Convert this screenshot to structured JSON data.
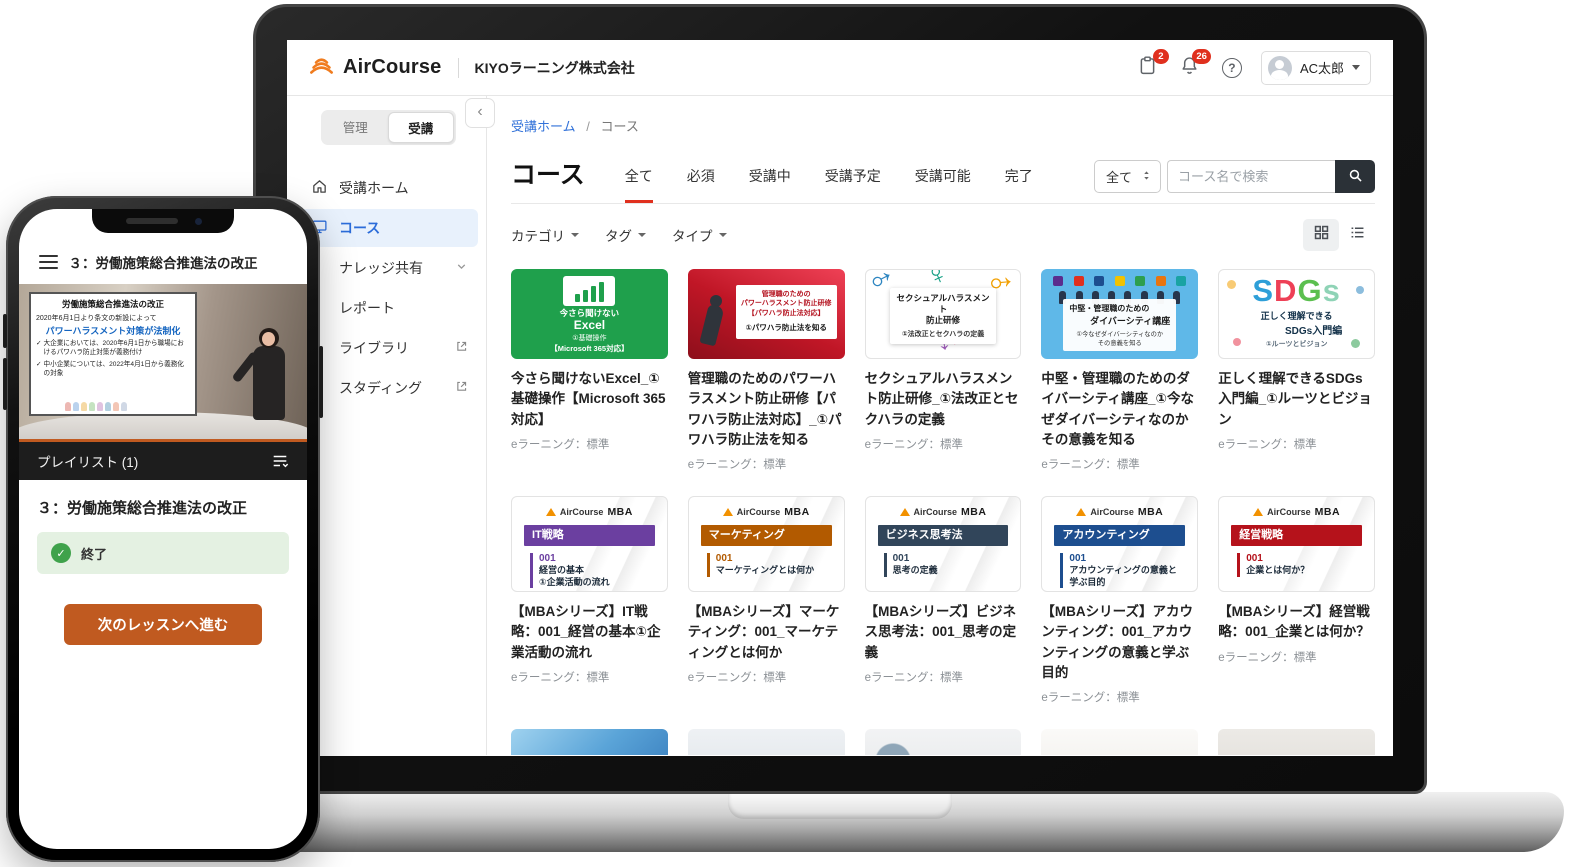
{
  "header": {
    "brand": "AirCourse",
    "company": "KIYOラーニング株式会社",
    "badges": {
      "tasks": "2",
      "alerts": "26"
    },
    "user": {
      "name": "AC太郎"
    }
  },
  "sidebar": {
    "toggle": {
      "admin": "管理",
      "learner": "受講"
    },
    "items": [
      {
        "label": "受講ホーム"
      },
      {
        "label": "コース"
      },
      {
        "label": "ナレッジ共有"
      },
      {
        "label": "レポート"
      },
      {
        "label": "ライブラリ"
      },
      {
        "label": "スタディング"
      }
    ]
  },
  "main": {
    "breadcrumb": {
      "home": "受講ホーム",
      "separator": "/",
      "current": "コース"
    },
    "title": "コース",
    "tabs": [
      {
        "label": "全て"
      },
      {
        "label": "必須"
      },
      {
        "label": "受講中"
      },
      {
        "label": "受講予定"
      },
      {
        "label": "受講可能"
      },
      {
        "label": "完了"
      }
    ],
    "search": {
      "category": "全て",
      "placeholder": "コース名で検索"
    },
    "filters": [
      {
        "label": "カテゴリ"
      },
      {
        "label": "タグ"
      },
      {
        "label": "タイプ"
      }
    ]
  },
  "courses": {
    "row1": [
      {
        "title": "今さら聞けないExcel_①基礎操作【Microsoft 365対応】",
        "meta": "eラーニング：標準",
        "thumb": {
          "line1": "今さら聞けない",
          "line2": "Excel",
          "line3": "①基礎操作",
          "line4": "【Microsoft 365対応】"
        }
      },
      {
        "title": "管理職のためのパワーハラスメント防止研修【パワハラ防止法対応】_①パワハラ防止法を知る",
        "meta": "eラーニング：標準",
        "thumb": {
          "line1": "管理職のための",
          "line2": "パワーハラスメント防止研修",
          "line3": "【パワハラ防止法対応】",
          "line4": "①パワハラ防止法を知る"
        }
      },
      {
        "title": "セクシュアルハラスメント防止研修_①法改正とセクハラの定義",
        "meta": "eラーニング：標準",
        "thumb": {
          "line1": "セクシュアルハラスメント",
          "line2": "防止研修",
          "line3": "①法改正とセクハラの定義"
        }
      },
      {
        "title": "中堅・管理職のためのダイバーシティ講座_①今なぜダイバーシティなのかその意義を知る",
        "meta": "eラーニング：標準",
        "thumb": {
          "line1": "中堅・管理職のための",
          "line2": "ダイバーシティ講座",
          "line3": "①今なぜダイバーシティなのか",
          "line4": "その意義を知る"
        }
      },
      {
        "title": "正しく理解できるSDGs入門編_①ルーツとビジョン",
        "meta": "eラーニング：標準",
        "thumb": {
          "big_s": "S",
          "big_d": "D",
          "big_g": "G",
          "big_s2": "s",
          "line1": "正しく理解できる",
          "line2": "SDGs入門編",
          "line3": "①ルーツとビジョン"
        }
      }
    ],
    "mba_logo": {
      "name": "AirCourse",
      "tag": "MBA"
    },
    "mba": [
      {
        "banner": "IT戦略",
        "banner_color": "#6b3fa0",
        "num": "001",
        "lines": [
          "経営の基本",
          "①企業活動の流れ"
        ],
        "title": "【MBAシリーズ】IT戦略：001_経営の基本①企業活動の流れ",
        "meta": "eラーニング：標準"
      },
      {
        "banner": "マーケティング",
        "banner_color": "#b25a00",
        "num": "001",
        "lines": [
          "マーケティングとは何か"
        ],
        "title": "【MBAシリーズ】マーケティング：001_マーケティングとは何か",
        "meta": "eラーニング：標準"
      },
      {
        "banner": "ビジネス思考法",
        "banner_color": "#31455a",
        "num": "001",
        "lines": [
          "思考の定義"
        ],
        "title": "【MBAシリーズ】ビジネス思考法：001_思考の定義",
        "meta": "eラーニング：標準"
      },
      {
        "banner": "アカウンティング",
        "banner_color": "#1d4e8f",
        "num": "001",
        "lines": [
          "アカウンティングの意義と",
          "学ぶ目的"
        ],
        "title": "【MBAシリーズ】アカウンティング：001_アカウンティングの意義と学ぶ目的",
        "meta": "eラーニング：標準"
      },
      {
        "banner": "経営戦略",
        "banner_color": "#b5121b",
        "num": "001",
        "lines": [
          "企業とは何か？"
        ],
        "title": "【MBAシリーズ】経営戦略：001_企業とは何か？",
        "meta": "eラーニング：標準"
      }
    ]
  },
  "phone": {
    "header_title": "３：労働施策総合推進法の改正",
    "video": {
      "slide_title": "労働施策総合推進法の改正",
      "slide_intro": "2020年6月1日より条文の新設によって",
      "slide_highlight": "パワーハラスメント対策が法制化",
      "bullet1": "大企業においては、2020年6月1日から職場におけるパワハラ防止対策が義務付け",
      "bullet2": "中小企業については、2022年4月1日から義務化の対象"
    },
    "playlist_label": "プレイリスト (1)",
    "lesson_title": "３：労働施策総合推進法の改正",
    "status_label": "終了",
    "next_button": "次のレッスンへ進む"
  },
  "colors": {
    "brand_orange": "#f07c1f",
    "badge_red": "#e0301e",
    "tab_active_red": "#e0301e",
    "link_blue": "#3272d9",
    "sidebar_active_bg": "#e8f1fc",
    "sidebar_active_text": "#2b6cd9",
    "search_button_bg": "#2b3137",
    "excel_green": "#1fa04c",
    "pawahara_red": "#c01626",
    "diversity_blue": "#5fb8e8",
    "success_green": "#3fa24b",
    "success_bg": "#e4f1e2",
    "playlist_bar": "#1d1d1d",
    "next_button_orange": "#c05a20"
  }
}
